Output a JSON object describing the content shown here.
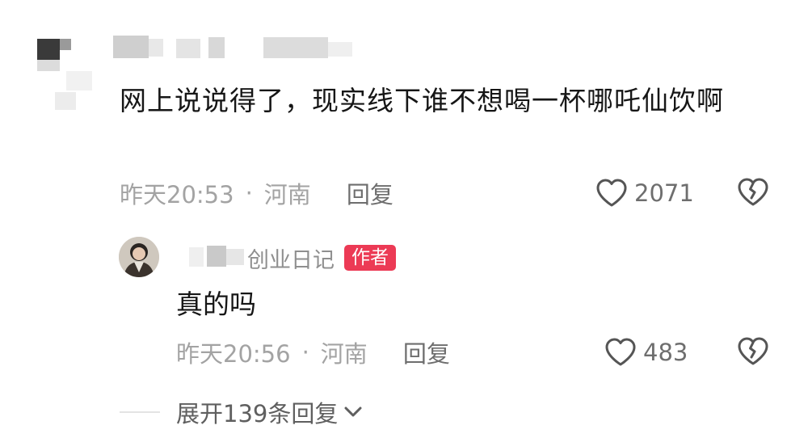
{
  "comment": {
    "text": "网上说说得了，现实线下谁不想喝一杯哪吒仙饮啊",
    "time": "昨天20:53",
    "separator": "·",
    "location": "河南",
    "reply_label": "回复",
    "like_count": "2071"
  },
  "reply": {
    "author_name": "创业日记",
    "author_badge": "作者",
    "text": "真的吗",
    "time": "昨天20:56",
    "separator": "·",
    "location": "河南",
    "reply_label": "回复",
    "like_count": "483"
  },
  "expand": {
    "label": "展开139条回复"
  },
  "colors": {
    "badge": "#ec3a55",
    "meta": "#a3a3a3",
    "action": "#6e6e6e"
  },
  "icons": [
    "heart-icon",
    "broken-heart-icon",
    "chevron-down-icon"
  ]
}
